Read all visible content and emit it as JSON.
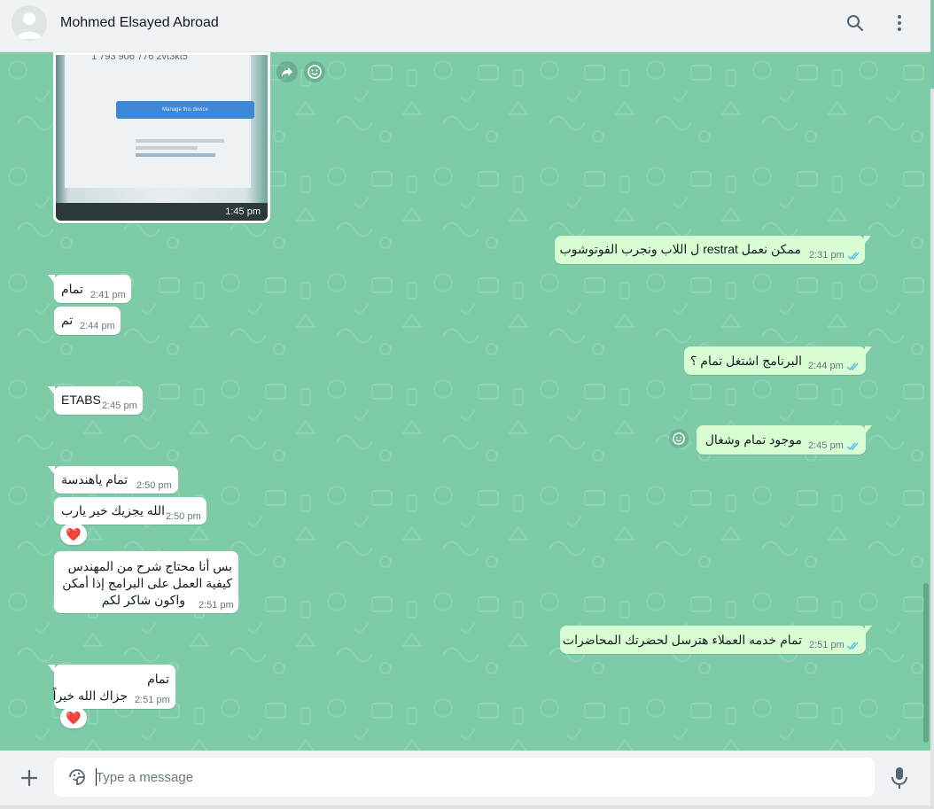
{
  "header": {
    "contact_name": "Mohmed Elsayed Abroad",
    "icons": [
      "search-icon",
      "menu-dots-icon"
    ]
  },
  "image_message": {
    "time": "1:45 pm",
    "photo_text": "1 793 906 776   2vt3kt5",
    "photo_button": "Manage this device"
  },
  "messages": [
    {
      "dir": "out",
      "text": "ممكن نعمل restrat ل اللاب ونجرب الفوتوشوب",
      "time": "2:31 pm",
      "read": true
    },
    {
      "dir": "in",
      "text": "تمام",
      "time": "2:41 pm"
    },
    {
      "dir": "in",
      "text": "تم",
      "time": "2:44 pm"
    },
    {
      "dir": "out",
      "text": "البرنامج اشتغل تمام ؟",
      "time": "2:44 pm",
      "read": true
    },
    {
      "dir": "in",
      "text": "ETABS",
      "time": "2:45 pm"
    },
    {
      "dir": "out",
      "text": "موجود تمام وشغال",
      "time": "2:45 pm",
      "read": true
    },
    {
      "dir": "in",
      "text": "تمام ياهندسة",
      "time": "2:50 pm"
    },
    {
      "dir": "in",
      "text": "الله يجزيك خير يارب",
      "time": "2:50 pm",
      "reaction": "❤️"
    },
    {
      "dir": "in",
      "lines": [
        "بس أنا محتاج شرح من المهندس",
        "كيفية العمل على البرامج إذا أمكن",
        "واكون شاكر لكم"
      ],
      "time": "2:51 pm"
    },
    {
      "dir": "out",
      "text": "تمام خدمه العملاء هترسل لحضرتك المحاضرات",
      "time": "2:51 pm",
      "read": true
    },
    {
      "dir": "in",
      "lines": [
        "تمام",
        "جزاك الله خيراً"
      ],
      "time": "2:51 pm",
      "reaction": "❤️"
    }
  ],
  "composer": {
    "placeholder": "Type a message"
  },
  "colors": {
    "chat_background": "#7ecba8",
    "outgoing_bubble": "#d9fdd3",
    "incoming_bubble": "#ffffff",
    "read_ticks": "#53bdeb"
  }
}
